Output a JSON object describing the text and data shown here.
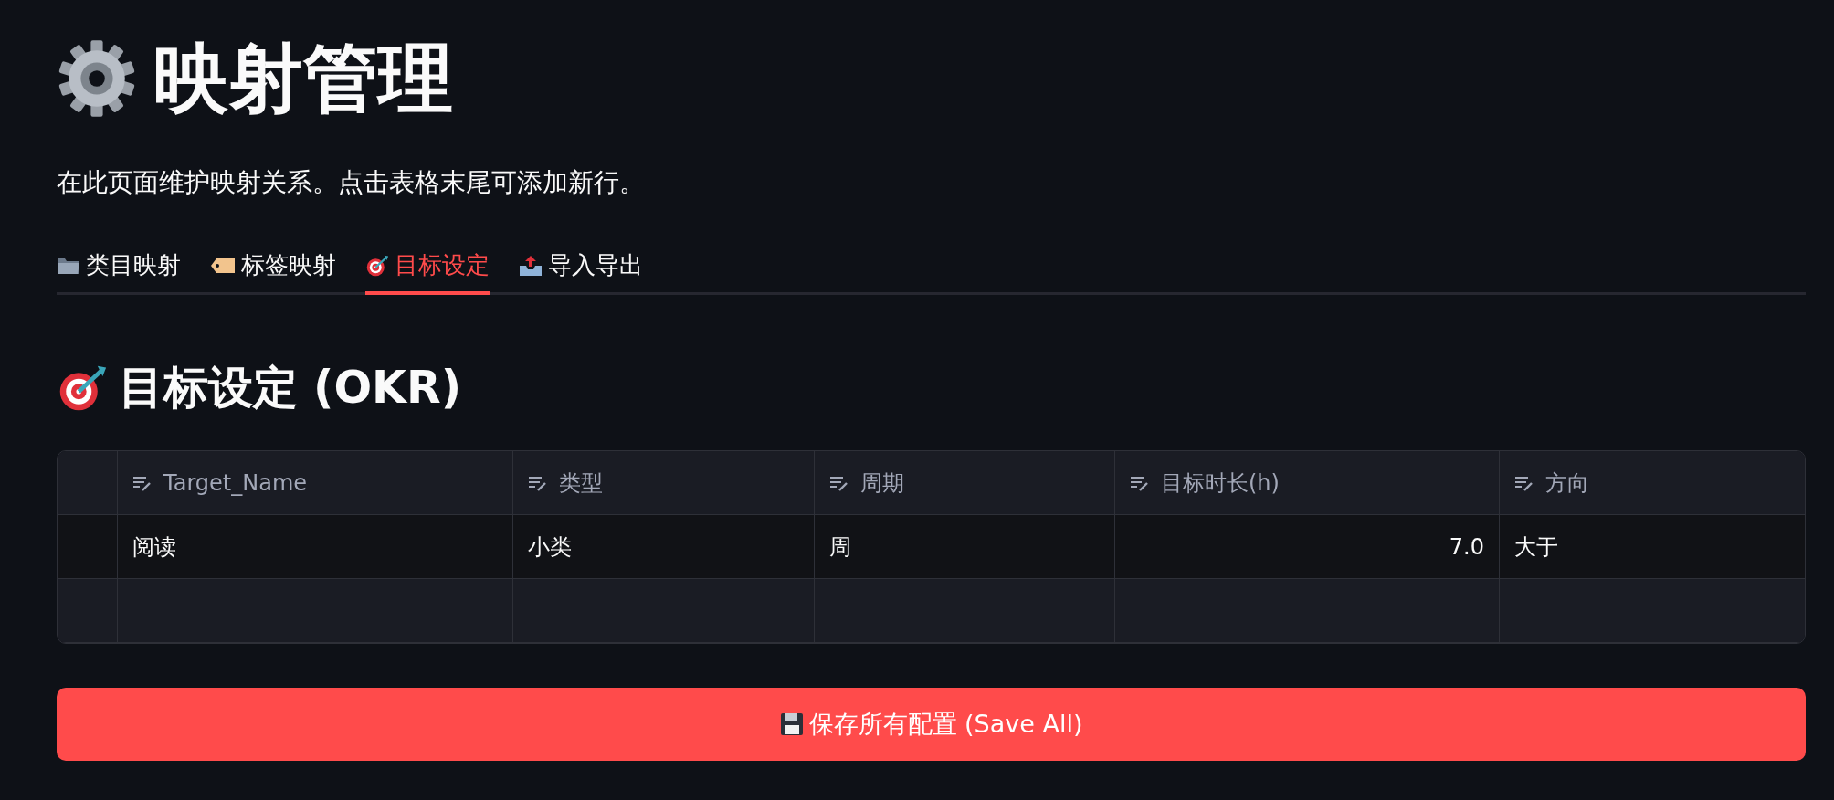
{
  "title": "映射管理",
  "description": "在此页面维护映射关系。点击表格末尾可添加新行。",
  "tabs": [
    {
      "label": "类目映射",
      "kind": "folder",
      "selected": false
    },
    {
      "label": "标签映射",
      "kind": "tag",
      "selected": false
    },
    {
      "label": "目标设定",
      "kind": "target",
      "selected": true
    },
    {
      "label": "导入导出",
      "kind": "outbox",
      "selected": false
    }
  ],
  "section": {
    "title": "目标设定 (OKR)"
  },
  "table": {
    "columns": [
      {
        "label": "Target_Name",
        "kind": "text"
      },
      {
        "label": "类型",
        "kind": "text"
      },
      {
        "label": "周期",
        "kind": "text"
      },
      {
        "label": "目标时长(h)",
        "kind": "number"
      },
      {
        "label": "方向",
        "kind": "text"
      }
    ],
    "rows": [
      [
        "阅读",
        "小类",
        "周",
        "7.0",
        "大于"
      ]
    ]
  },
  "save_button": {
    "label": "保存所有配置 (Save All)"
  }
}
